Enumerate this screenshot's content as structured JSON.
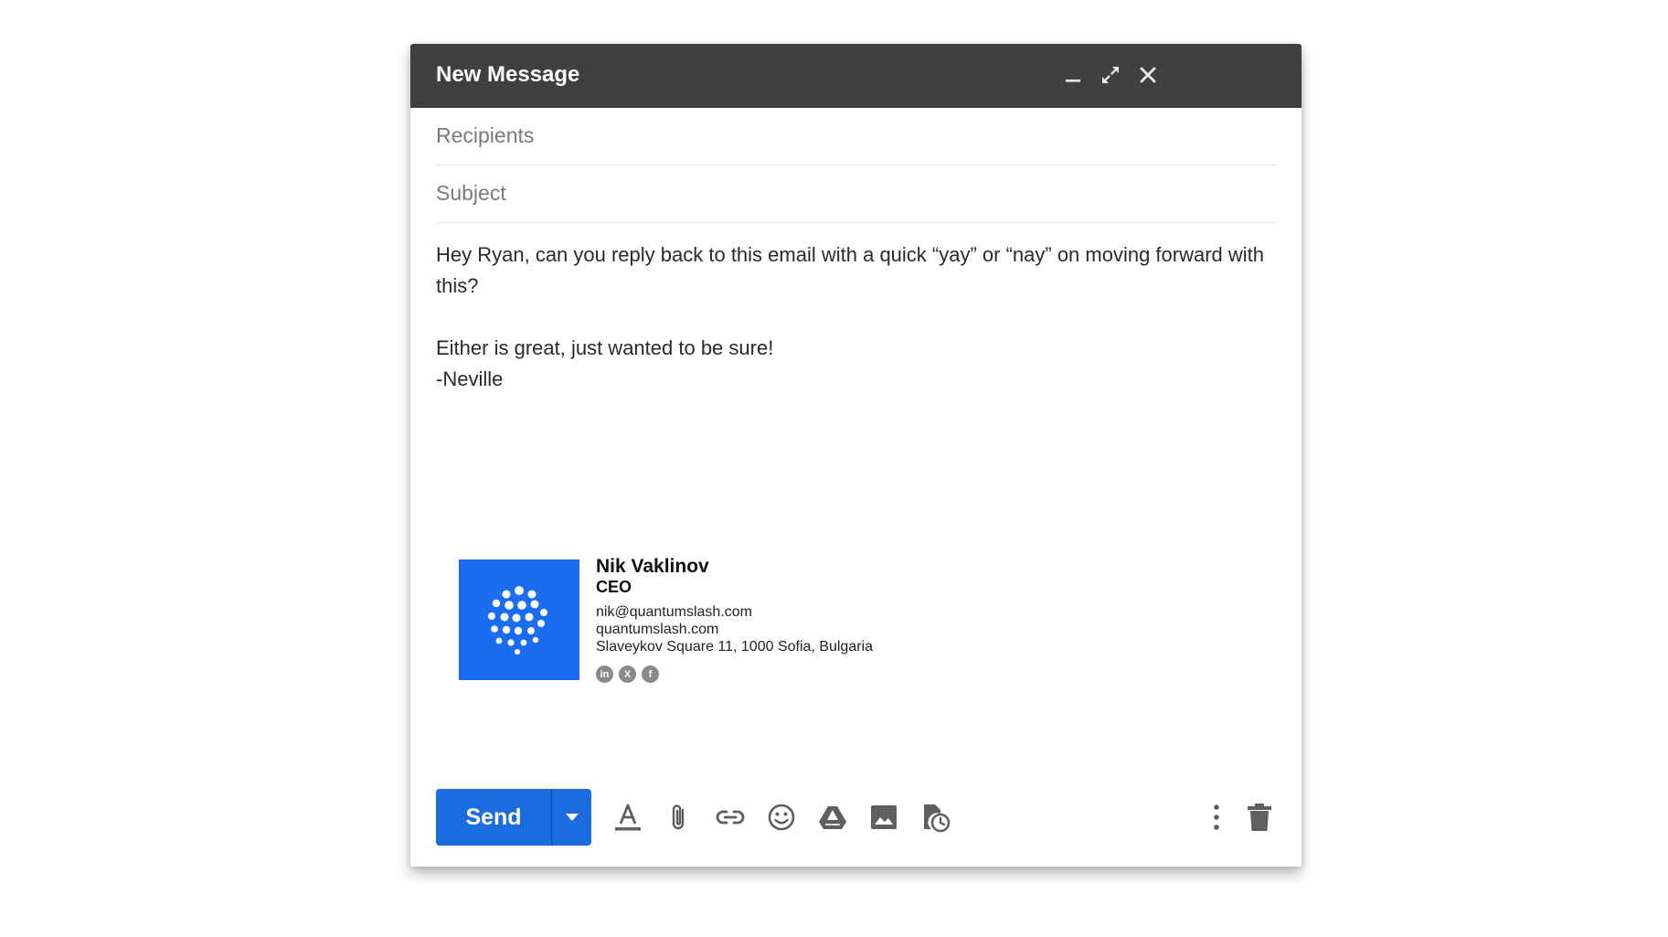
{
  "window": {
    "title": "New Message"
  },
  "fields": {
    "recipients_placeholder": "Recipients",
    "subject_placeholder": "Subject"
  },
  "body": {
    "line1": "Hey Ryan, can you reply back to this email with a quick “yay” or “nay” on moving forward with this?",
    "line2": "Either is great, just wanted to be sure!",
    "line3": "-Neville"
  },
  "signature": {
    "name": "Nik Vaklinov",
    "role": "CEO",
    "email": "nik@quantumslash.com",
    "website": "quantumslash.com",
    "address": "Slaveykov Square 11, 1000 Sofia, Bulgaria",
    "socials": {
      "linkedin": "in",
      "x": "X",
      "facebook": "f"
    },
    "logo_color": "#1a6cf0"
  },
  "toolbar": {
    "send_label": "Send",
    "send_color": "#1a6ce0",
    "icons": [
      "text-format-icon",
      "attach-icon",
      "link-icon",
      "emoji-icon",
      "drive-icon",
      "image-icon",
      "schedule-icon",
      "more-options-icon",
      "trash-icon"
    ]
  },
  "colors": {
    "titlebar": "#404040",
    "icon_gray": "#5f5f5f"
  }
}
